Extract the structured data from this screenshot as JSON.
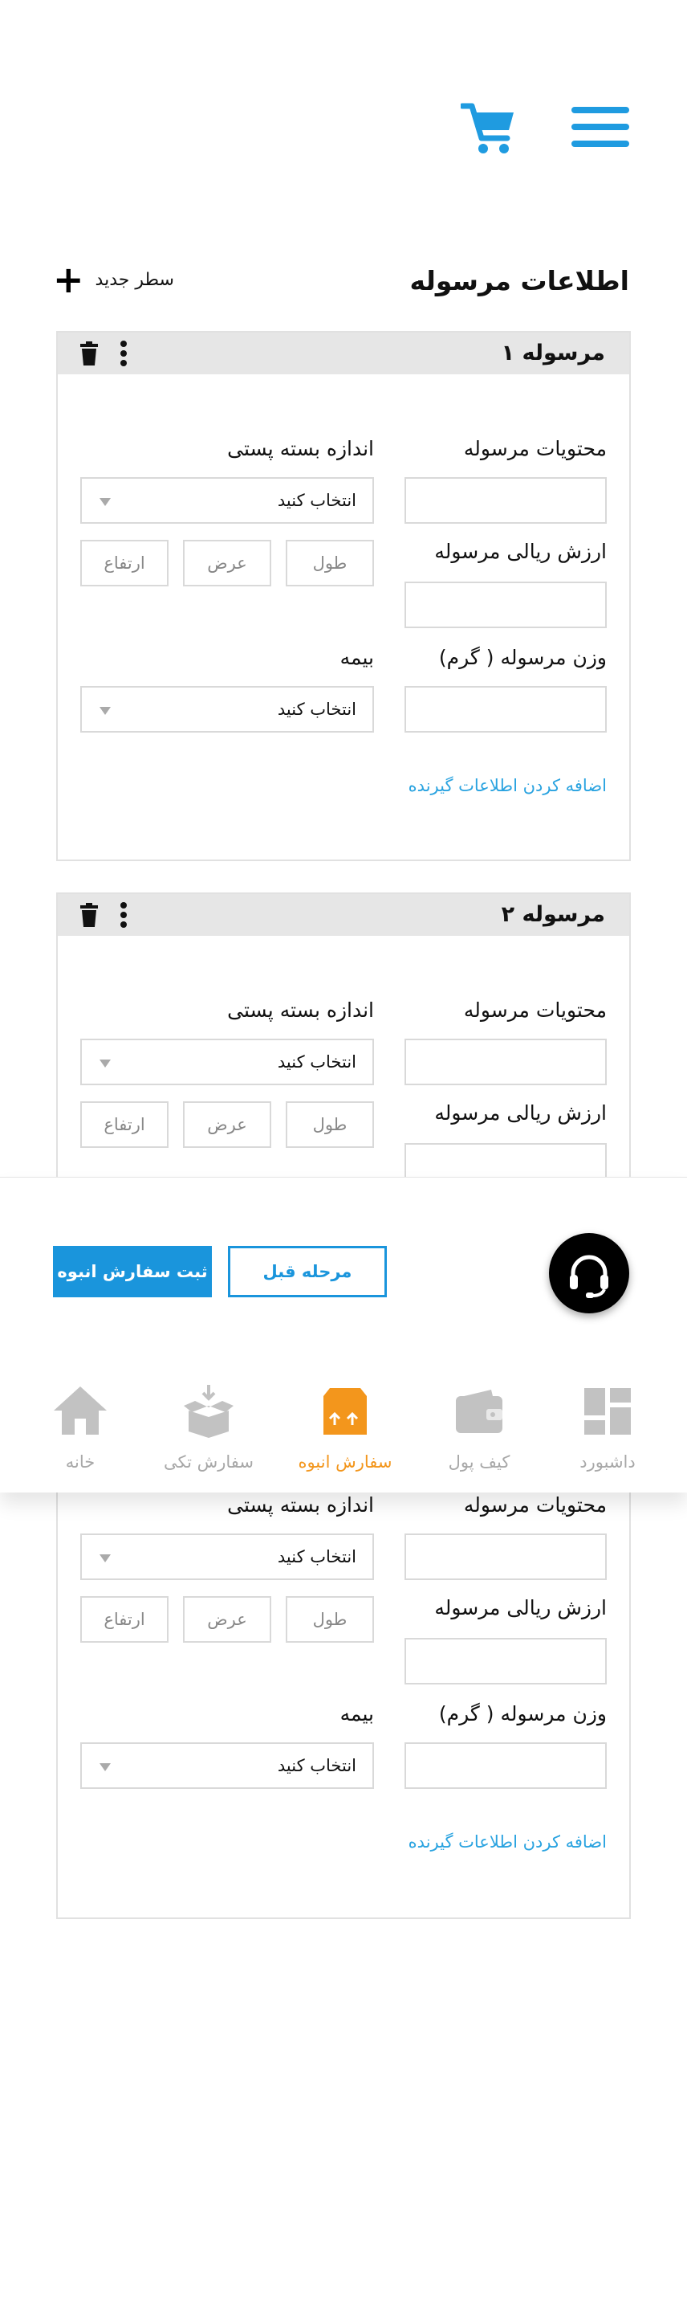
{
  "header": {
    "menu_icon": "hamburger-menu-icon",
    "cart_icon": "shopping-cart-icon",
    "accent_color": "#1f9be0"
  },
  "section": {
    "title": "اطلاعات مرسوله",
    "add_row_label": "سطر جدید"
  },
  "labels": {
    "contents": "محتویات مرسوله",
    "package_size": "اندازه بسته پستی",
    "value": "ارزش ریالی مرسوله",
    "weight": "وزن مرسوله ( گرم)",
    "insurance": "بیمه",
    "select_placeholder": "انتخاب کنید",
    "length": "طول",
    "width": "عرض",
    "height": "ارتفاع",
    "add_receiver": "اضافه کردن اطلاعات گیرنده"
  },
  "shipments": [
    {
      "title": "مرسوله ۱"
    },
    {
      "title": "مرسوله ۲"
    }
  ],
  "actions": {
    "submit": "ثبت سفارش انبوه",
    "previous": "مرحله قبل"
  },
  "bottom_nav": [
    {
      "label": "داشبورد",
      "icon": "dashboard-icon",
      "active": false
    },
    {
      "label": "کیف پول",
      "icon": "wallet-icon",
      "active": false
    },
    {
      "label": "سفارش انبوه",
      "icon": "bulk-order-box-icon",
      "active": true
    },
    {
      "label": "سفارش تکی",
      "icon": "single-order-box-icon",
      "active": false
    },
    {
      "label": "خانه",
      "icon": "home-icon",
      "active": false
    }
  ],
  "colors": {
    "primary": "#1a95dc",
    "active_nav": "#f3961c",
    "inactive_nav": "#a8a8a8",
    "link": "#2aa3e0"
  }
}
